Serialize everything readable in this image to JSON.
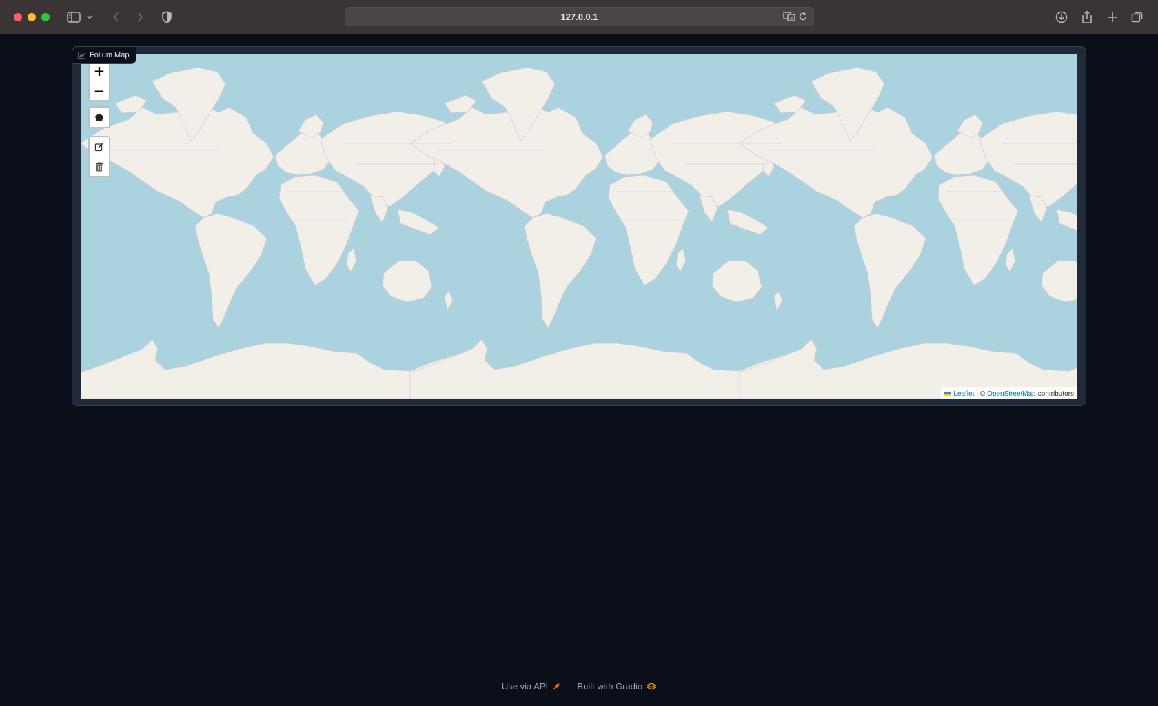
{
  "browser": {
    "url": "127.0.0.1"
  },
  "block": {
    "label": "Folium Map"
  },
  "map": {
    "zoom_in_label": "+",
    "zoom_out_label": "−",
    "attribution": {
      "leaflet": "Leaflet",
      "separator": "| ©",
      "osm": "OpenStreetMap",
      "contributors": "contributors"
    },
    "colors": {
      "water": "#aad3df",
      "land": "#f2efe9",
      "borders": "#d9c8d4"
    }
  },
  "footer": {
    "api_label": "Use via API",
    "separator": "·",
    "built_label": "Built with Gradio"
  }
}
